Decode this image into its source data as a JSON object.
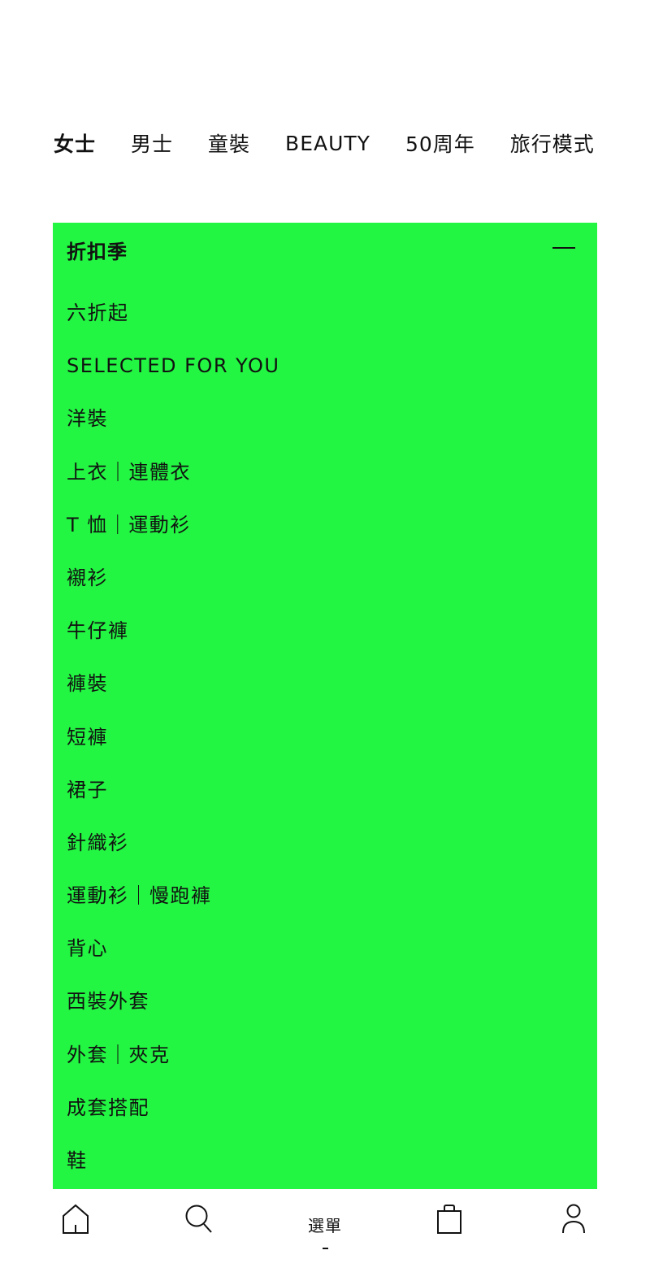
{
  "top_tabs": [
    {
      "label": "女士",
      "active": true
    },
    {
      "label": "男士",
      "active": false
    },
    {
      "label": "童裝",
      "active": false
    },
    {
      "label": "BEAUTY",
      "active": false
    },
    {
      "label": "50周年",
      "active": false
    },
    {
      "label": "旅行模式",
      "active": false
    }
  ],
  "panel": {
    "title": "折扣季",
    "background": "#22f542",
    "items": [
      "六折起",
      "SELECTED FOR YOU",
      "洋裝",
      "上衣｜連體衣",
      "T 恤｜運動衫",
      "襯衫",
      "牛仔褲",
      "褲裝",
      "短褲",
      "裙子",
      "針織衫",
      "運動衫｜慢跑褲",
      "背心",
      "西裝外套",
      "外套｜夾克",
      "成套搭配",
      "鞋"
    ]
  },
  "bottom_nav": {
    "home_icon": "home-icon",
    "search_icon": "search-icon",
    "menu_label": "選單",
    "bag_icon": "shopping-bag-icon",
    "account_icon": "user-icon"
  }
}
